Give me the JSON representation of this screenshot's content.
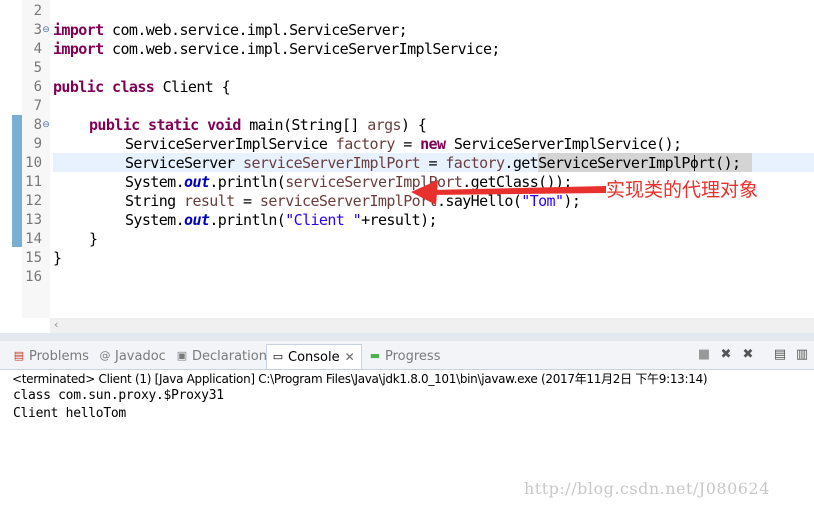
{
  "editor": {
    "line_numbers": [
      "2",
      "3",
      "4",
      "5",
      "6",
      "7",
      "8",
      "9",
      "10",
      "11",
      "12",
      "13",
      "14",
      "15",
      "16"
    ],
    "lines": {
      "l3_kw": "import",
      "l3_rest": " com.web.service.impl.ServiceServer;",
      "l4_kw": "import",
      "l4_rest": " com.web.service.impl.ServiceServerImplService;",
      "l6_kw1": "public",
      "l6_kw2": "class",
      "l6_rest": " Client {",
      "l8_kw1": "public",
      "l8_kw2": "static",
      "l8_kw3": "void",
      "l8_a": " main(String[] ",
      "l8_var": "args",
      "l8_b": ") {",
      "l9_a": "ServiceServerImplService ",
      "l9_var": "factory",
      "l9_b": " = ",
      "l9_kw": "new",
      "l9_c": " ServiceServerImplService();",
      "l10_a": "ServiceServer ",
      "l10_var": "serviceServerImplPort",
      "l10_b": " = ",
      "l10_var2": "factory",
      "l10_c": ".getServiceServerImplPort();",
      "l11_a": "System.",
      "l11_field": "out",
      "l11_b": ".println(",
      "l11_var": "serviceServerImplPort",
      "l11_c": ".getClass());",
      "l12_a": "String ",
      "l12_var": "result",
      "l12_b": " = ",
      "l12_var2": "serviceServerImplPort",
      "l12_c": ".sayHello(",
      "l12_str": "\"Tom\"",
      "l12_d": ");",
      "l13_a": "System.",
      "l13_field": "out",
      "l13_b": ".println(",
      "l13_str": "\"Client \"",
      "l13_c": "+result);",
      "l14": "}",
      "l15": "}"
    },
    "annotation": "实现类的代理对象",
    "annotation_color": "#e8302c"
  },
  "console": {
    "tabs": [
      {
        "label": "Problems",
        "icon": "problems-icon"
      },
      {
        "label": "Javadoc",
        "icon": "javadoc-icon"
      },
      {
        "label": "Declaration",
        "icon": "declaration-icon"
      },
      {
        "label": "Console",
        "icon": "console-icon",
        "active": true
      },
      {
        "label": "Progress",
        "icon": "progress-icon"
      }
    ],
    "status": "<terminated> Client (1) [Java Application] C:\\Program Files\\Java\\jdk1.8.0_101\\bin\\javaw.exe (2017年11月2日 下午9:13:14)",
    "output": [
      "class com.sun.proxy.$Proxy31",
      "Client helloTom"
    ]
  },
  "watermark": "http://blog.csdn.net/J080624"
}
